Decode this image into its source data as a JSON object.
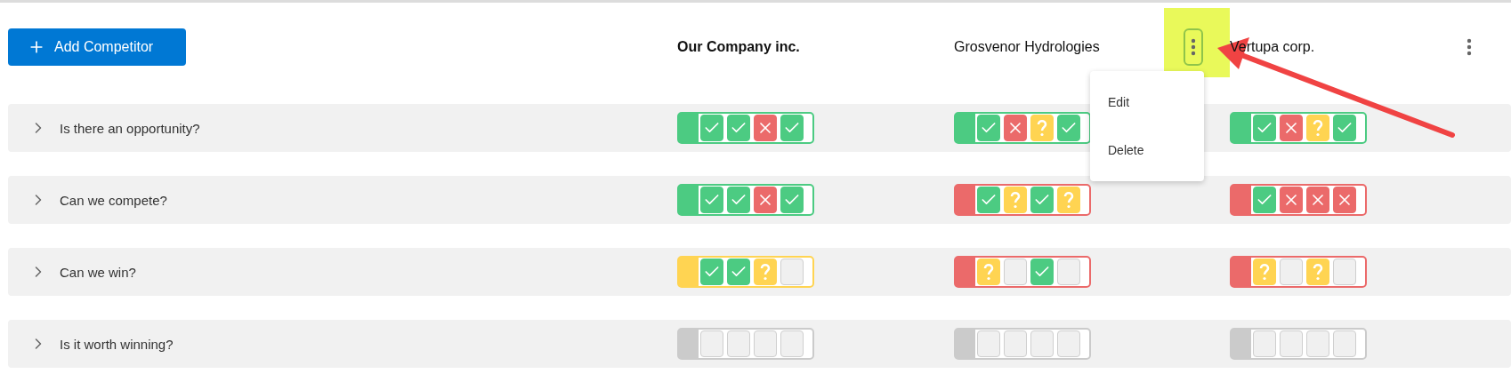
{
  "add_button": {
    "label": "Add Competitor"
  },
  "competitors": [
    {
      "name": "Our Company inc.",
      "primary": true,
      "has_menu": false,
      "menu_open": false
    },
    {
      "name": "Grosvenor Hydrologies",
      "primary": false,
      "has_menu": true,
      "menu_open": true
    },
    {
      "name": "Vertupa corp.",
      "primary": false,
      "has_menu": true,
      "menu_open": false
    }
  ],
  "menu": {
    "items": [
      "Edit",
      "Delete"
    ]
  },
  "questions": [
    {
      "label": "Is there an opportunity?",
      "expanded": false,
      "scores": [
        {
          "color": "#4ccb82",
          "marks": [
            {
              "kind": "check"
            },
            {
              "kind": "check"
            },
            {
              "kind": "cross"
            },
            {
              "kind": "check"
            }
          ]
        },
        {
          "color": "#4ccb82",
          "marks": [
            {
              "kind": "check"
            },
            {
              "kind": "cross"
            },
            {
              "kind": "question"
            },
            {
              "kind": "check"
            }
          ]
        },
        {
          "color": "#4ccb82",
          "marks": [
            {
              "kind": "check"
            },
            {
              "kind": "cross"
            },
            {
              "kind": "question"
            },
            {
              "kind": "check"
            }
          ]
        }
      ]
    },
    {
      "label": "Can we compete?",
      "expanded": false,
      "scores": [
        {
          "color": "#4ccb82",
          "marks": [
            {
              "kind": "check"
            },
            {
              "kind": "check"
            },
            {
              "kind": "cross"
            },
            {
              "kind": "check"
            }
          ]
        },
        {
          "color": "#eb6a6a",
          "marks": [
            {
              "kind": "check"
            },
            {
              "kind": "question"
            },
            {
              "kind": "check"
            },
            {
              "kind": "question"
            }
          ]
        },
        {
          "color": "#eb6a6a",
          "marks": [
            {
              "kind": "check"
            },
            {
              "kind": "cross"
            },
            {
              "kind": "cross"
            },
            {
              "kind": "cross"
            }
          ]
        }
      ]
    },
    {
      "label": "Can we win?",
      "expanded": false,
      "scores": [
        {
          "color": "#ffd452",
          "marks": [
            {
              "kind": "check"
            },
            {
              "kind": "check"
            },
            {
              "kind": "question"
            },
            {
              "kind": "empty"
            }
          ]
        },
        {
          "color": "#eb6a6a",
          "marks": [
            {
              "kind": "question"
            },
            {
              "kind": "empty"
            },
            {
              "kind": "check"
            },
            {
              "kind": "empty"
            }
          ]
        },
        {
          "color": "#eb6a6a",
          "marks": [
            {
              "kind": "question"
            },
            {
              "kind": "empty"
            },
            {
              "kind": "question"
            },
            {
              "kind": "empty"
            }
          ]
        }
      ]
    },
    {
      "label": "Is it worth winning?",
      "expanded": false,
      "scores": [
        {
          "color": "#cbcbcb",
          "marks": [
            {
              "kind": "empty"
            },
            {
              "kind": "empty"
            },
            {
              "kind": "empty"
            },
            {
              "kind": "empty"
            }
          ]
        },
        {
          "color": "#cbcbcb",
          "marks": [
            {
              "kind": "empty"
            },
            {
              "kind": "empty"
            },
            {
              "kind": "empty"
            },
            {
              "kind": "empty"
            }
          ]
        },
        {
          "color": "#cbcbcb",
          "marks": [
            {
              "kind": "empty"
            },
            {
              "kind": "empty"
            },
            {
              "kind": "empty"
            },
            {
              "kind": "empty"
            }
          ]
        }
      ]
    }
  ]
}
